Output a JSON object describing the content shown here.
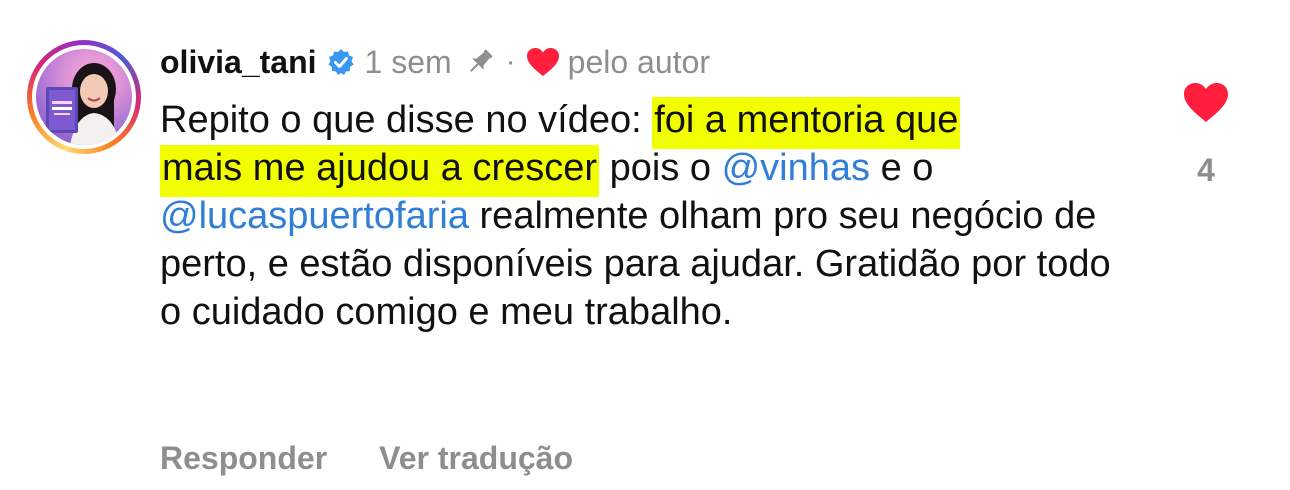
{
  "comment": {
    "username": "olivia_tani",
    "time": "1 sem",
    "separator": "·",
    "liked_by": "pelo autor",
    "text_plain_1": "Repito o que disse no vídeo: ",
    "highlight_1": "foi a mentoria que",
    "highlight_2": "mais me ajudou a crescer",
    "text_plain_2": " pois o ",
    "mention_1": "@vinhas",
    "text_plain_3": " e o ",
    "mention_2": "@lucaspuertofaria",
    "text_plain_4": " realmente olham pro seu negócio de perto, e estão disponíveis para ajudar. Gratidão por todo o cuidado comigo e meu trabalho.",
    "like_count": "4"
  },
  "actions": {
    "reply": "Responder",
    "translate": "Ver tradução"
  },
  "icons": {
    "verified": "verified-badge-icon",
    "pin": "pin-icon",
    "author_heart": "heart-icon",
    "like": "heart-icon"
  },
  "colors": {
    "highlight": "#f2ff00",
    "mention": "#2f7ed8",
    "heart": "#ff1f3d",
    "muted": "#8e8e8e",
    "verified": "#3897f0"
  }
}
